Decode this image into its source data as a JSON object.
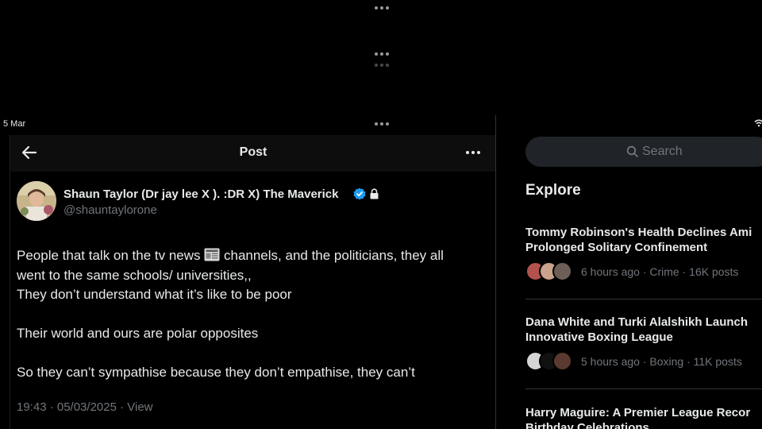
{
  "status_bar": {
    "date": "5 Mar",
    "wifi_icon": "wifi-icon"
  },
  "post_view": {
    "header_title": "Post",
    "author": {
      "name": "Shaun Taylor (Dr jay lee X ). :DR X) The Maverick",
      "handle": "@shauntaylorone",
      "verified": true,
      "protected": true
    },
    "body": {
      "line1_before": "People that talk on the tv news ",
      "line1_after": " channels, and the politicians, they all",
      "line2": "went to the same schools/ universities,,",
      "line3": "They don’t understand what it’s like to be poor",
      "line4": "Their world and ours are polar opposites",
      "line5": "So they can’t sympathise because they don’t empathise, they can’t"
    },
    "meta": "19:43 · 05/03/2025 · View"
  },
  "sidebar": {
    "search_placeholder": "Search",
    "explore_title": "Explore",
    "trends": [
      {
        "title_line1": "Tommy Robinson's Health Declines Ami",
        "title_line2": "Prolonged Solitary Confinement",
        "meta": "6 hours ago · Crime · 16K posts"
      },
      {
        "title_line1": "Dana White and Turki Alalshikh Launch",
        "title_line2": "Innovative Boxing League",
        "meta": "5 hours ago · Boxing · 11K posts"
      },
      {
        "title_line1": "Harry Maguire: A Premier League Recor",
        "title_line2": "Birthday Celebrations",
        "meta": ""
      }
    ]
  },
  "colors": {
    "accent": "#1d9bf0",
    "text": "#e7e9ea",
    "muted": "#71767b",
    "background": "#000000"
  }
}
